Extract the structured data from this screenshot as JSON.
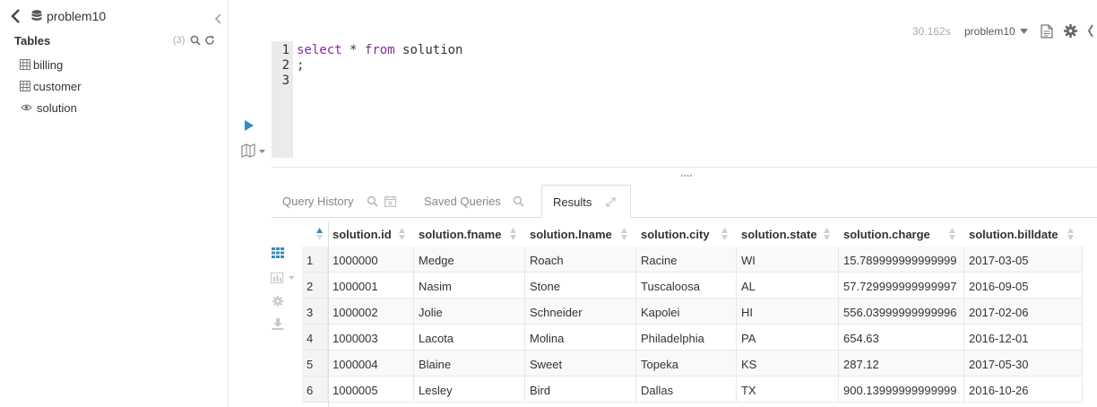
{
  "left": {
    "db_name": "problem10",
    "tables_title": "Tables",
    "tables_count": "(3)",
    "tables": [
      {
        "name": "billing",
        "icon": "table-icon"
      },
      {
        "name": "customer",
        "icon": "table-icon"
      },
      {
        "name": "solution",
        "icon": "eye-icon"
      }
    ]
  },
  "topbar": {
    "elapsed": "30.162s",
    "database": "problem10"
  },
  "editor": {
    "line_numbers": [
      "1",
      "2",
      "3"
    ],
    "lines": [
      "select * from solution",
      ";",
      ""
    ]
  },
  "tabs": [
    {
      "label": "Query History",
      "active": false
    },
    {
      "label": "Saved Queries",
      "active": false
    },
    {
      "label": "Results",
      "active": true
    }
  ],
  "results": {
    "columns": [
      "solution.id",
      "solution.fname",
      "solution.lname",
      "solution.city",
      "solution.state",
      "solution.charge",
      "solution.billdate"
    ],
    "rows": [
      [
        "1",
        "1000000",
        "Medge",
        "Roach",
        "Racine",
        "WI",
        "15.789999999999999",
        "2017-03-05"
      ],
      [
        "2",
        "1000001",
        "Nasim",
        "Stone",
        "Tuscaloosa",
        "AL",
        "57.729999999999997",
        "2016-09-05"
      ],
      [
        "3",
        "1000002",
        "Jolie",
        "Schneider",
        "Kapolei",
        "HI",
        "556.03999999999996",
        "2017-02-06"
      ],
      [
        "4",
        "1000003",
        "Lacota",
        "Molina",
        "Philadelphia",
        "PA",
        "654.63",
        "2016-12-01"
      ],
      [
        "5",
        "1000004",
        "Blaine",
        "Sweet",
        "Topeka",
        "KS",
        "287.12",
        "2017-05-30"
      ],
      [
        "6",
        "1000005",
        "Lesley",
        "Bird",
        "Dallas",
        "TX",
        "900.13999999999999",
        "2016-10-26"
      ]
    ]
  },
  "colors": {
    "accent": "#338bb8",
    "keyword": "#7e2d95",
    "muted": "#aaaaaa"
  }
}
